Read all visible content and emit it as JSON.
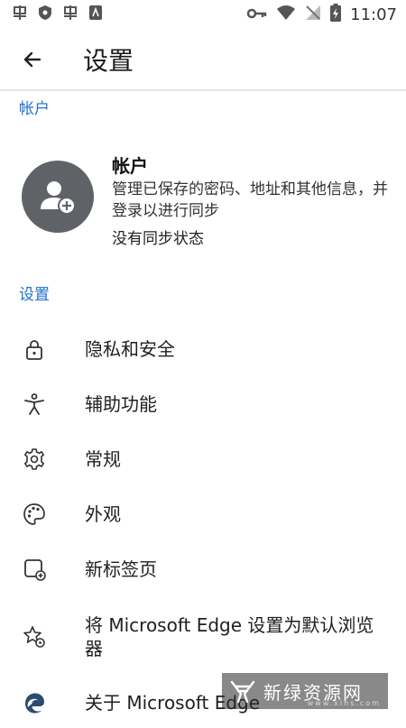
{
  "status_bar": {
    "time": "11:07",
    "left_icons": [
      "app-icon",
      "shield-icon",
      "app-icon",
      "store-icon"
    ],
    "right_icons": [
      "vpn-key-icon",
      "wifi-icon",
      "no-signal-icon",
      "battery-icon"
    ]
  },
  "header": {
    "title": "设置"
  },
  "sections": {
    "account": "帐户",
    "settings": "设置"
  },
  "account": {
    "title": "帐户",
    "description": "管理已保存的密码、地址和其他信息，并登录以进行同步",
    "sync_status": "没有同步状态"
  },
  "settings_items": [
    {
      "label": "隐私和安全",
      "icon": "lock-icon"
    },
    {
      "label": "辅助功能",
      "icon": "accessibility-icon"
    },
    {
      "label": "常规",
      "icon": "gear-icon"
    },
    {
      "label": "外观",
      "icon": "palette-icon"
    },
    {
      "label": "新标签页",
      "icon": "new-tab-icon"
    },
    {
      "label": "将 Microsoft Edge 设置为默认浏览器",
      "icon": "star-gear-icon"
    },
    {
      "label": "关于 Microsoft Edge",
      "icon": "edge-logo-icon"
    }
  ],
  "watermark": {
    "text": "新绿资源网",
    "sub": "www.xlhs.com"
  },
  "colors": {
    "accent": "#1e6fd0",
    "avatar_bg": "#5f6368"
  }
}
